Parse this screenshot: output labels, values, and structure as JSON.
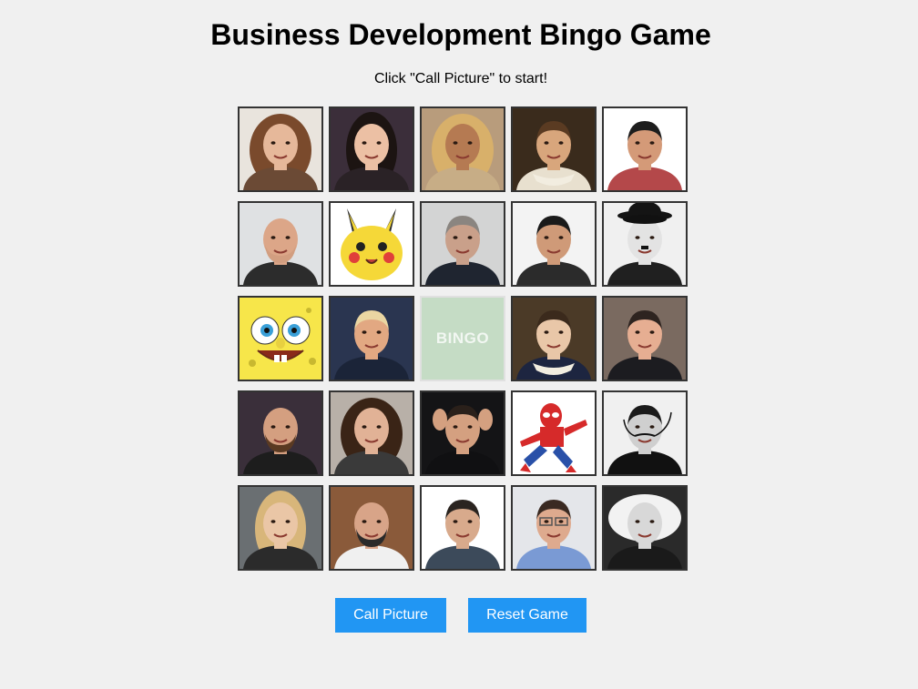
{
  "title": "Business Development Bingo Game",
  "status": "Click \"Call Picture\" to start!",
  "free_space_label": "BINGO",
  "buttons": {
    "call_picture": "Call Picture",
    "reset_game": "Reset Game"
  },
  "colors": {
    "background": "#f0f0f0",
    "button": "#2196f3",
    "button_text": "#ffffff",
    "free_cell": "#c5dcc5",
    "cell_border": "#333333"
  },
  "board": [
    [
      {
        "subject": "woman with curly hair",
        "bg": "#e9e4dd",
        "skin": "#e6b89a",
        "hair": "#7a4a2c",
        "shirt": "#6b4a35",
        "feature": "curly"
      },
      {
        "subject": "woman with dark hair smiling",
        "bg": "#3b2e3a",
        "skin": "#ecc0a4",
        "hair": "#1c1412",
        "shirt": "#2a2226",
        "feature": "long"
      },
      {
        "subject": "woman with blonde wavy hair",
        "bg": "#b89c7c",
        "skin": "#b57a52",
        "hair": "#d8b06a",
        "shirt": "#c7ad86",
        "feature": "curly"
      },
      {
        "subject": "renaissance portrait painting",
        "bg": "#3a2b1c",
        "skin": "#d8a67c",
        "hair": "#5a3b22",
        "shirt": "#e8e0cf",
        "feature": "collar"
      },
      {
        "subject": "smiling man short hair",
        "bg": "#ffffff",
        "skin": "#d49a78",
        "hair": "#1d1d1d",
        "shirt": "#b4484a",
        "feature": "short"
      }
    ],
    [
      {
        "subject": "bald man with beard",
        "bg": "#dfe1e3",
        "skin": "#dca688",
        "hair": "#d29e80",
        "shirt": "#2c2c2c",
        "feature": "beard"
      },
      {
        "subject": "yellow cartoon character",
        "bg": "#ffffff",
        "skin": "#f5d838",
        "hair": "#f5d838",
        "shirt": "#f5d838",
        "feature": "cartoon-yellow"
      },
      {
        "subject": "man with short grey hair",
        "bg": "#d3d4d4",
        "skin": "#c9a08a",
        "hair": "#8a8580",
        "shirt": "#1f2530",
        "feature": "short"
      },
      {
        "subject": "smiling man dark hair",
        "bg": "#f3f3f3",
        "skin": "#cf9a78",
        "hair": "#1a1a1a",
        "shirt": "#2b2b2b",
        "feature": "short"
      },
      {
        "subject": "black and white man with bowler hat",
        "bg": "#f0f0f0",
        "skin": "#e3e3e3",
        "hair": "#141414",
        "shirt": "#202020",
        "feature": "hat"
      }
    ],
    [
      {
        "subject": "yellow sponge cartoon",
        "bg": "#f7e64a",
        "skin": "#f7e64a",
        "hair": "#f7e64a",
        "shirt": "#f7e64a",
        "feature": "sponge"
      },
      {
        "subject": "man with blond hair dark suit",
        "bg": "#2a3550",
        "skin": "#e2a882",
        "hair": "#ead6a2",
        "shirt": "#1b2438",
        "feature": "short"
      },
      {
        "subject": "free space",
        "bg": "#c5dcc5",
        "skin": "",
        "hair": "",
        "shirt": "",
        "feature": "free"
      },
      {
        "subject": "portrait painting man uniform",
        "bg": "#4b3a27",
        "skin": "#e9c7a8",
        "hair": "#3b2a1c",
        "shirt": "#1d2540",
        "feature": "collar"
      },
      {
        "subject": "man in dark suit",
        "bg": "#7a6a60",
        "skin": "#e6ae92",
        "hair": "#2e2420",
        "shirt": "#1c1c20",
        "feature": "short"
      }
    ],
    [
      {
        "subject": "bearded man smiling",
        "bg": "#3a2f3a",
        "skin": "#d49f80",
        "hair": "#5a3a22",
        "shirt": "#1d1d1d",
        "feature": "beard"
      },
      {
        "subject": "woman with curly dark hair",
        "bg": "#b8b0a8",
        "skin": "#e1b296",
        "hair": "#3a2416",
        "shirt": "#3a3a3a",
        "feature": "curly"
      },
      {
        "subject": "man with hands on head",
        "bg": "#141416",
        "skin": "#d4a080",
        "hair": "#2a201a",
        "shirt": "#101012",
        "feature": "hands"
      },
      {
        "subject": "red and blue costumed hero",
        "bg": "#ffffff",
        "skin": "#d62a2a",
        "hair": "#d62a2a",
        "shirt": "#2950a8",
        "feature": "hero"
      },
      {
        "subject": "black and white man with mustache",
        "bg": "#f0f0f0",
        "skin": "#cfcfcf",
        "hair": "#1a1a1a",
        "shirt": "#111111",
        "feature": "mustache"
      }
    ],
    [
      {
        "subject": "woman with long blonde hair",
        "bg": "#6a6f72",
        "skin": "#eac6a6",
        "hair": "#d8b67a",
        "shirt": "#2b2b2b",
        "feature": "long"
      },
      {
        "subject": "bearded man white chef coat",
        "bg": "#8a5a3a",
        "skin": "#d8a488",
        "hair": "#2a2a2a",
        "shirt": "#f0f0f0",
        "feature": "beard"
      },
      {
        "subject": "man dark hair smiling",
        "bg": "#ffffff",
        "skin": "#d8aa8c",
        "hair": "#2a2420",
        "shirt": "#3c4a5a",
        "feature": "short"
      },
      {
        "subject": "man with glasses",
        "bg": "#e4e6ea",
        "skin": "#deaa8e",
        "hair": "#3a2a22",
        "shirt": "#7a9ad4",
        "feature": "glasses"
      },
      {
        "subject": "black and white man white hair",
        "bg": "#2a2a2a",
        "skin": "#d8d8d8",
        "hair": "#f2f2f2",
        "shirt": "#1a1a1a",
        "feature": "wild"
      }
    ]
  ]
}
